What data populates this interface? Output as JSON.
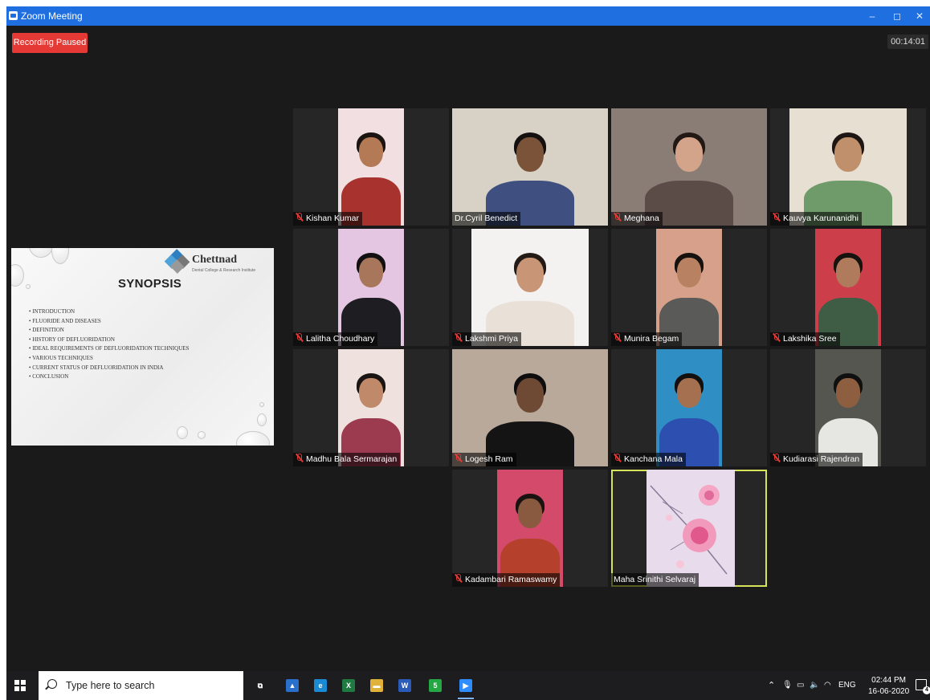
{
  "window": {
    "title": "Zoom Meeting",
    "minimize": "–",
    "restore": "◻",
    "close": "✕"
  },
  "recording": {
    "label": "Recording Paused",
    "elapsed": "00:14:01"
  },
  "slide": {
    "logo_name": "Chettnad",
    "logo_sub": "Dental College & Research Institute",
    "title": "SYNOPSIS",
    "items": [
      "INTRODUCTION",
      "FLUORIDE AND DISEASES",
      "DEFINITION",
      "HISTORY OF DEFLUORIDATION",
      "IDEAL REQUIREMENTS OF DEFLUORIDATION TECHNIQUES",
      "VARIOUS TECHNIQUES",
      "CURRENT STATUS OF DEFLUORIDATION IN INDIA",
      "CONCLUSION"
    ]
  },
  "participants": [
    {
      "name": "Kishan Kumar",
      "muted": true,
      "active": false,
      "bg": "#f2dfe2",
      "skin": "#b47a55",
      "shirt": "#a8322e",
      "hair": "#1c1410"
    },
    {
      "name": "Dr.Cyril Benedict",
      "muted": false,
      "active": false,
      "bg": "#d8d2c6",
      "skin": "#7a5338",
      "shirt": "#3e4f80",
      "hair": "#141010"
    },
    {
      "name": "Meghana",
      "muted": true,
      "active": false,
      "bg": "#8a7d75",
      "skin": "#d3a48a",
      "shirt": "#5c4c48",
      "hair": "#221814"
    },
    {
      "name": "Kauvya Karunanidhi",
      "muted": true,
      "active": false,
      "bg": "#e7dfd2",
      "skin": "#c08f6c",
      "shirt": "#6f9b6a",
      "hair": "#1e1612"
    },
    {
      "name": "Lalitha Choudhary",
      "muted": true,
      "active": false,
      "bg": "#e4c6e2",
      "skin": "#a8765a",
      "shirt": "#1e1e22",
      "hair": "#121010"
    },
    {
      "name": "Lakshmi Priya",
      "muted": true,
      "active": false,
      "bg": "#f4f2f0",
      "skin": "#c89676",
      "shirt": "#e9e0d8",
      "hair": "#231a16"
    },
    {
      "name": "Munira Begam",
      "muted": true,
      "active": false,
      "bg": "#d6a08a",
      "skin": "#b88262",
      "shirt": "#5a5a58",
      "hair": "#161210"
    },
    {
      "name": "Lakshika Sree",
      "muted": true,
      "active": false,
      "bg": "#cc3f4a",
      "skin": "#b07a5c",
      "shirt": "#3f5c44",
      "hair": "#161210"
    },
    {
      "name": "Madhu Bala Sermarajan",
      "muted": true,
      "active": false,
      "bg": "#efe1de",
      "skin": "#c08a6a",
      "shirt": "#9c3a50",
      "hair": "#1a1412"
    },
    {
      "name": "Logesh Ram",
      "muted": true,
      "active": false,
      "bg": "#b9a99a",
      "skin": "#6e4a34",
      "shirt": "#141414",
      "hair": "#0e0c0c"
    },
    {
      "name": "Kanchana Mala",
      "muted": true,
      "active": false,
      "bg": "#2f8fc4",
      "skin": "#a47050",
      "shirt": "#2d4fb0",
      "hair": "#141010"
    },
    {
      "name": "Kudiarasi Rajendran",
      "muted": true,
      "active": false,
      "bg": "#55564f",
      "skin": "#8e5e40",
      "shirt": "#e6e6e2",
      "hair": "#101010"
    },
    {
      "name": "Kadambari Ramaswamy",
      "muted": true,
      "active": false,
      "bg": "#d34a6a",
      "skin": "#8a5a40",
      "shirt": "#b5412c",
      "hair": "#1a1210"
    },
    {
      "name": "Maha Srinithi Selvaraj",
      "muted": false,
      "active": true,
      "bg": "#e8dcec",
      "skin": "#f0a9c4",
      "shirt": "#c66a9a",
      "hair": "#7c5a7a",
      "is_picture": true
    }
  ],
  "taskbar": {
    "search_placeholder": "Type here to search",
    "apps": [
      {
        "name": "task-view-icon",
        "glyph": "⧉",
        "color": "#1d1d1f",
        "running": false
      },
      {
        "name": "file-explorer-accounts-icon",
        "glyph": "▲",
        "color": "#2a6fc9",
        "running": false
      },
      {
        "name": "edge-browser-icon",
        "glyph": "e",
        "color": "#1a8ad4",
        "running": false
      },
      {
        "name": "excel-icon",
        "glyph": "X",
        "color": "#1f7a42",
        "running": false
      },
      {
        "name": "file-explorer-icon",
        "glyph": "▬",
        "color": "#e0b23a",
        "running": false
      },
      {
        "name": "word-icon",
        "glyph": "W",
        "color": "#2b5bb8",
        "running": false
      },
      {
        "name": "whatsapp-icon",
        "glyph": "5",
        "color": "#25a744",
        "running": false
      },
      {
        "name": "zoom-icon",
        "glyph": "▶",
        "color": "#2d8cff",
        "running": true
      }
    ],
    "tray": {
      "language": "ENG",
      "time": "02:44 PM",
      "date": "16-06-2020",
      "notifications": "4"
    }
  }
}
